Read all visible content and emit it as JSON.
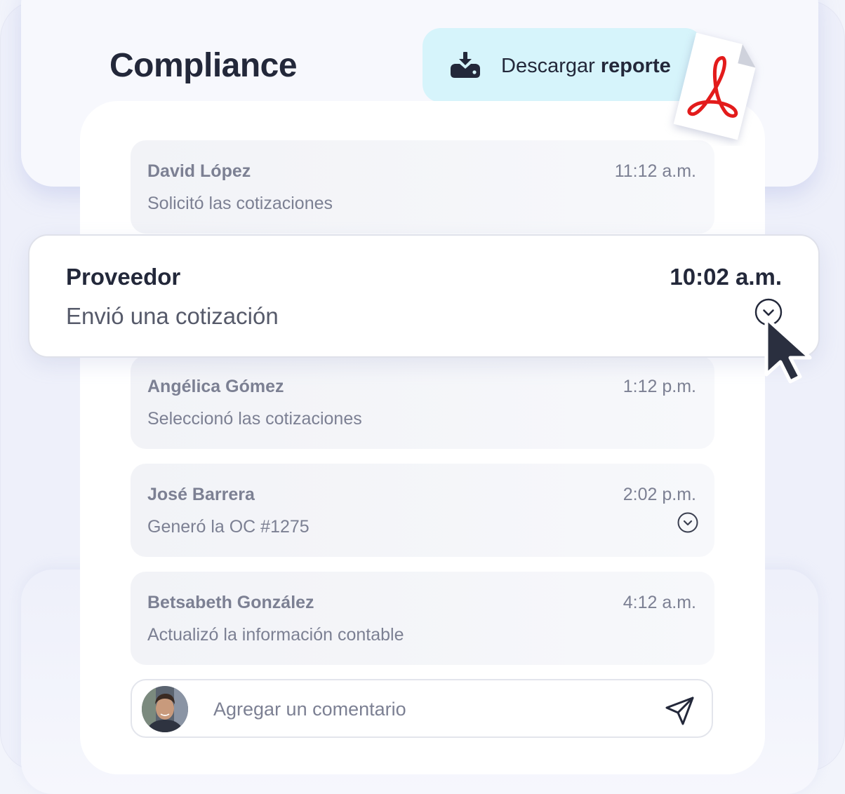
{
  "header": {
    "title": "Compliance",
    "download": {
      "label_regular": "Descargar",
      "label_bold": "reporte",
      "icon": "download-icon"
    },
    "attachment_icon": "pdf-file-icon"
  },
  "featured_entry": {
    "name": "Proveedor",
    "action": "Envió una cotización",
    "time": "10:02 a.m.",
    "icon": "chevron-down-circle-icon"
  },
  "entries": [
    {
      "name": "David López",
      "action": "Solicitó las cotizaciones",
      "time": "11:12 a.m."
    },
    {
      "name": "Angélica Gómez",
      "action": "Seleccionó las cotizaciones",
      "time": "1:12 p.m."
    },
    {
      "name": "José Barrera",
      "action": "Generó la OC #1275",
      "time": "2:02 p.m.",
      "icon": "chevron-down-circle-icon"
    },
    {
      "name": "Betsabeth González",
      "action": "Actualizó la información contable",
      "time": "4:12 a.m."
    }
  ],
  "comment": {
    "placeholder": "Agregar un comentario",
    "send_icon": "send-icon",
    "avatar": "user-avatar"
  },
  "colors": {
    "accent_light": "#d6f4fb",
    "text_dark": "#23283a",
    "text_muted": "#7c8093",
    "pdf_red": "#e31b1b"
  }
}
